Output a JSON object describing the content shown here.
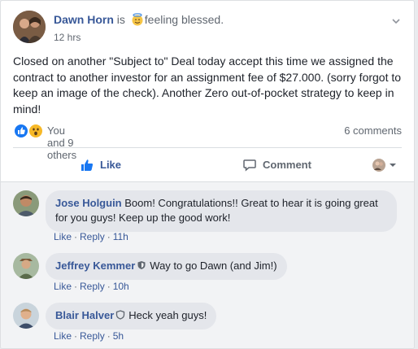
{
  "post": {
    "author": "Dawn Horn",
    "is_text": "is",
    "feeling_icon": "smiling-halo-emoji",
    "feeling": "feeling blessed.",
    "time": "12 hrs",
    "text": "Closed on another \"Subject to\" Deal today accept this time we assigned the contract to another investor for an assignment fee of $27.000. (sorry forgot to keep an image of the check). Another Zero out-of-pocket strategy to keep in mind!",
    "reactions_text": "You and 9 others",
    "comments_text": "6 comments",
    "colors": {
      "link": "#385898",
      "like_blue": "#1877f2",
      "wow_yellow": "#f7b928"
    }
  },
  "actions": {
    "like": "Like",
    "comment": "Comment"
  },
  "comments": [
    {
      "author": "Jose Holguin",
      "text": "Boom! Congratulations!! Great to hear it is going great for you guys! Keep up the good work!",
      "like": "Like",
      "reply": "Reply",
      "time": "11h"
    },
    {
      "author": "Jeffrey Kemmer",
      "text": "Way to go Dawn (and Jim!)",
      "like": "Like",
      "reply": "Reply",
      "time": "10h"
    },
    {
      "author": "Blair Halver",
      "text": "Heck yeah guys!",
      "like": "Like",
      "reply": "Reply",
      "time": "5h"
    }
  ]
}
